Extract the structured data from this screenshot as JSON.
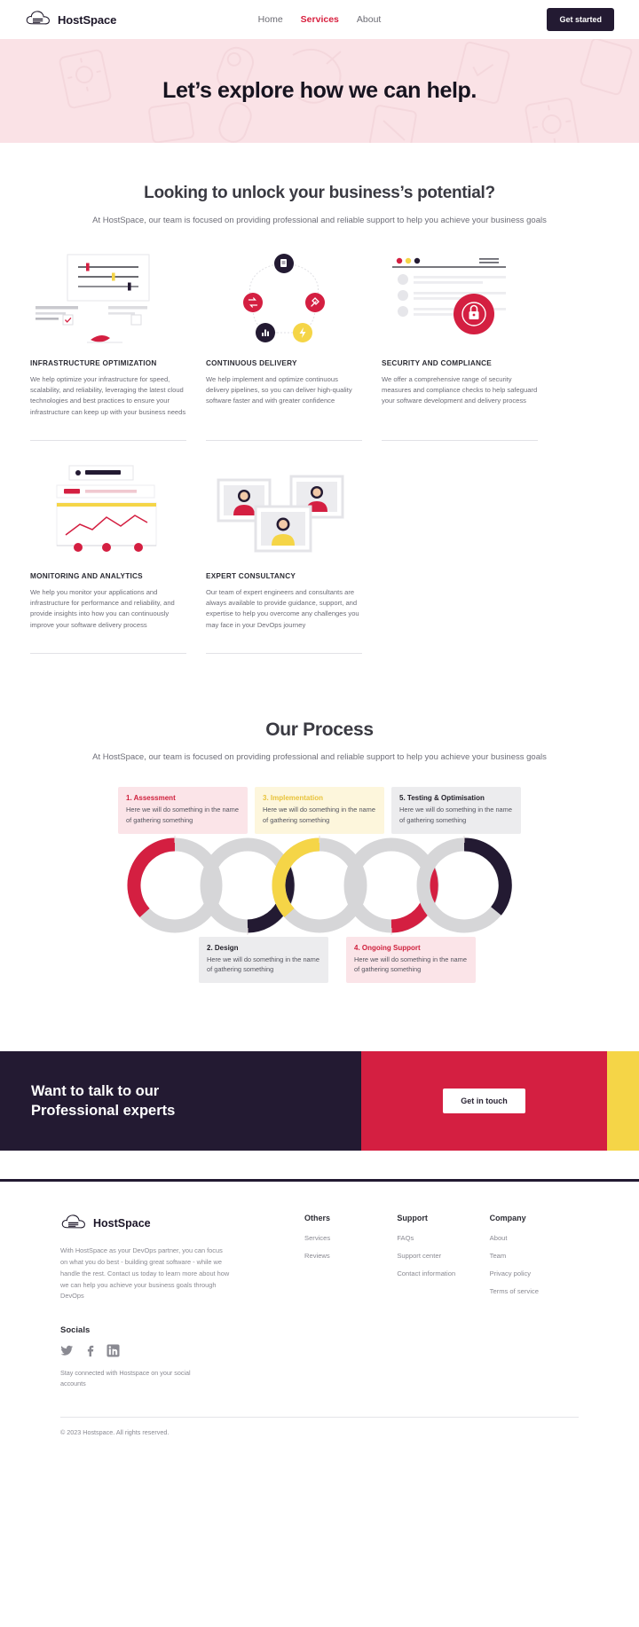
{
  "header": {
    "brand": "HostSpace",
    "logo_icon": "cloud-server-icon",
    "nav": [
      {
        "label": "Home",
        "active": false
      },
      {
        "label": "Services",
        "active": true
      },
      {
        "label": "About",
        "active": false
      }
    ],
    "cta_label": "Get started"
  },
  "hero": {
    "title": "Let’s explore how we can help."
  },
  "intro": {
    "title": "Looking to unlock your business’s potential?",
    "subtitle": "At HostSpace, our team is focused on providing professional and reliable support to help you achieve your business goals"
  },
  "services": [
    {
      "illustration": "sliders-settings-illustration",
      "title": "INFRASTRUCTURE OPTIMIZATION",
      "desc": "We help optimize your infrastructure for speed, scalability, and reliability, leveraging the latest cloud technologies and best practices to ensure your infrastructure can keep up with your business needs"
    },
    {
      "illustration": "pipeline-cycle-illustration",
      "title": "CONTINUOUS DELIVERY",
      "desc": "We help implement and optimize continuous delivery pipelines, so you can deliver high-quality software faster and with greater confidence"
    },
    {
      "illustration": "browser-lock-illustration",
      "title": "SECURITY AND COMPLIANCE",
      "desc": "We offer a comprehensive range of security measures and compliance checks to help safeguard your software development and delivery process"
    },
    {
      "illustration": "analytics-chart-illustration",
      "title": "MONITORING AND ANALYTICS",
      "desc": "We help you monitor your applications and infrastructure for performance and reliability, and provide insights into how you can continuously improve your software delivery process"
    },
    {
      "illustration": "team-avatars-illustration",
      "title": "EXPERT CONSULTANCY",
      "desc": "Our team of expert engineers and consultants are always available to provide guidance, support, and expertise to help you overcome any challenges you may face in your DevOps journey"
    }
  ],
  "process": {
    "title": "Our Process",
    "subtitle": "At HostSpace, our team is focused on providing professional and reliable support to help you achieve your business goals",
    "steps_top": [
      {
        "label": "1. Assessment",
        "text": "Here we will do something in the name of gathering something",
        "tone": "pink"
      },
      {
        "label": "3. Implementation",
        "text": "Here we will do something in the name of gathering something",
        "tone": "cream"
      },
      {
        "label": "5. Testing & Optimisation",
        "text": "Here we will do something in the name of gathering something",
        "tone": "gray"
      }
    ],
    "steps_bottom": [
      {
        "label": "2. Design",
        "text": "Here we will do something in the name of gathering something",
        "tone": "gray"
      },
      {
        "label": "4. Ongoing Support",
        "text": "Here we will do something in the name of gathering something",
        "tone": "pink"
      }
    ],
    "ring_colors": [
      "#d41f41",
      "#231a32",
      "#f5d547",
      "#d41f41",
      "#231a32"
    ],
    "ring_track": "#d6d6d8"
  },
  "banner": {
    "line1": "Want to talk to our",
    "line2": "Professional experts",
    "button": "Get in touch",
    "color_dark": "#231a32",
    "color_red": "#d41f41",
    "color_yellow": "#f5d547"
  },
  "footer": {
    "brand": "HostSpace",
    "blurb": "With HostSpace as your DevOps partner, you can focus on what you do best - building great software - while we handle the rest. Contact us today to learn more about how we can help you achieve your business goals through DevOps",
    "socials_heading": "Socials",
    "socials": [
      "twitter-icon",
      "facebook-icon",
      "linkedin-icon"
    ],
    "socials_note": "Stay connected with Hostspace on your social accounts",
    "columns": [
      {
        "heading": "Others",
        "links": [
          "Services",
          "Reviews"
        ]
      },
      {
        "heading": "Support",
        "links": [
          "FAQs",
          "Support center",
          "Contact information"
        ]
      },
      {
        "heading": "Company",
        "links": [
          "About",
          "Team",
          "Privacy policy",
          "Terms of service"
        ]
      }
    ],
    "copyright": "© 2023 Hostspace. All rights reserved."
  }
}
